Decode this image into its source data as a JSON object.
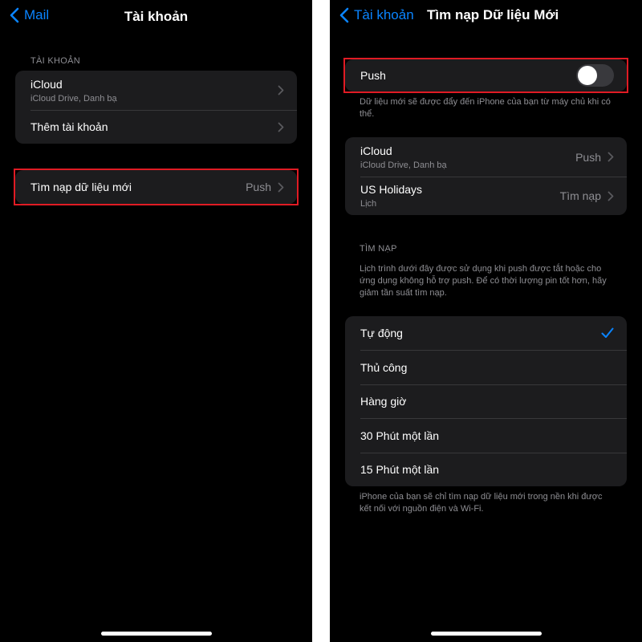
{
  "left": {
    "back_label": "Mail",
    "title": "Tài khoản",
    "section_header": "TÀI KHOẢN",
    "accounts": [
      {
        "title": "iCloud",
        "subtitle": "iCloud Drive, Danh bạ"
      },
      {
        "title": "Thêm tài khoản"
      }
    ],
    "fetch_row": {
      "title": "Tìm nạp dữ liệu mới",
      "value": "Push"
    }
  },
  "right": {
    "back_label": "Tài khoản",
    "title": "Tìm nạp Dữ liệu Mới",
    "push": {
      "label": "Push",
      "enabled": false
    },
    "push_footnote": "Dữ liệu mới sẽ được đẩy đến iPhone của bạn từ máy chủ khi có thể.",
    "accounts": [
      {
        "title": "iCloud",
        "subtitle": "iCloud Drive, Danh bạ",
        "value": "Push"
      },
      {
        "title": "US Holidays",
        "subtitle": "Lịch",
        "value": "Tìm nạp"
      }
    ],
    "fetch_header": "TÌM NẠP",
    "fetch_description": "Lịch trình dưới đây được sử dụng khi push được tắt hoặc cho ứng dụng không hỗ trợ push. Để có thời lượng pin tốt hơn, hãy giảm tần suất tìm nạp.",
    "schedule_options": [
      "Tự động",
      "Thủ công",
      "Hàng giờ",
      "30 Phút một lần",
      "15 Phút một lần"
    ],
    "selected_option": "Tự động",
    "schedule_footnote": "iPhone của bạn sẽ chỉ tìm nạp dữ liệu mới trong nền khi được kết nối với nguồn điện và Wi-Fi."
  },
  "colors": {
    "accent": "#0a84ff",
    "highlight": "#e01b24",
    "cell": "#1c1c1e",
    "background": "#000000"
  },
  "icons": [
    "chevron-left-icon",
    "chevron-right-icon",
    "checkmark-icon"
  ]
}
